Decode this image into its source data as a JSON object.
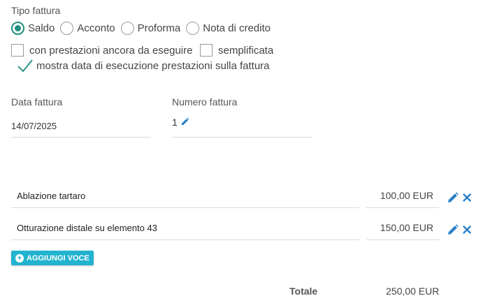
{
  "invoice_type": {
    "label": "Tipo fattura",
    "options": [
      {
        "label": "Saldo",
        "checked": true
      },
      {
        "label": "Acconto",
        "checked": false
      },
      {
        "label": "Proforma",
        "checked": false
      },
      {
        "label": "Nota di credito",
        "checked": false
      }
    ]
  },
  "options": {
    "pending_services": {
      "label": "con prestazioni ancora da eseguire",
      "checked": false
    },
    "simplified": {
      "label": "semplificata",
      "checked": false
    },
    "show_date": {
      "label": "mostra data di esecuzione prestazioni sulla fattura",
      "checked": true
    }
  },
  "fields": {
    "date": {
      "label": "Data fattura",
      "value": "14/07/2025"
    },
    "number": {
      "label": "Numero fattura",
      "value": "1"
    }
  },
  "items": [
    {
      "description": "Ablazione tartaro",
      "price": "100,00 EUR"
    },
    {
      "description": "Otturazione distale su elemento 43",
      "price": "150,00 EUR"
    }
  ],
  "add_button": {
    "label": "AGGIUNGI VOCE"
  },
  "total": {
    "label": "Totale",
    "value": "250,00 EUR"
  },
  "colors": {
    "accent": "#1f8f7e",
    "button": "#21b3cf",
    "edit_icon": "#2a7fc9"
  },
  "icons": {
    "edit": "pencil-icon",
    "remove": "close-icon",
    "add": "plus-circle-icon"
  }
}
